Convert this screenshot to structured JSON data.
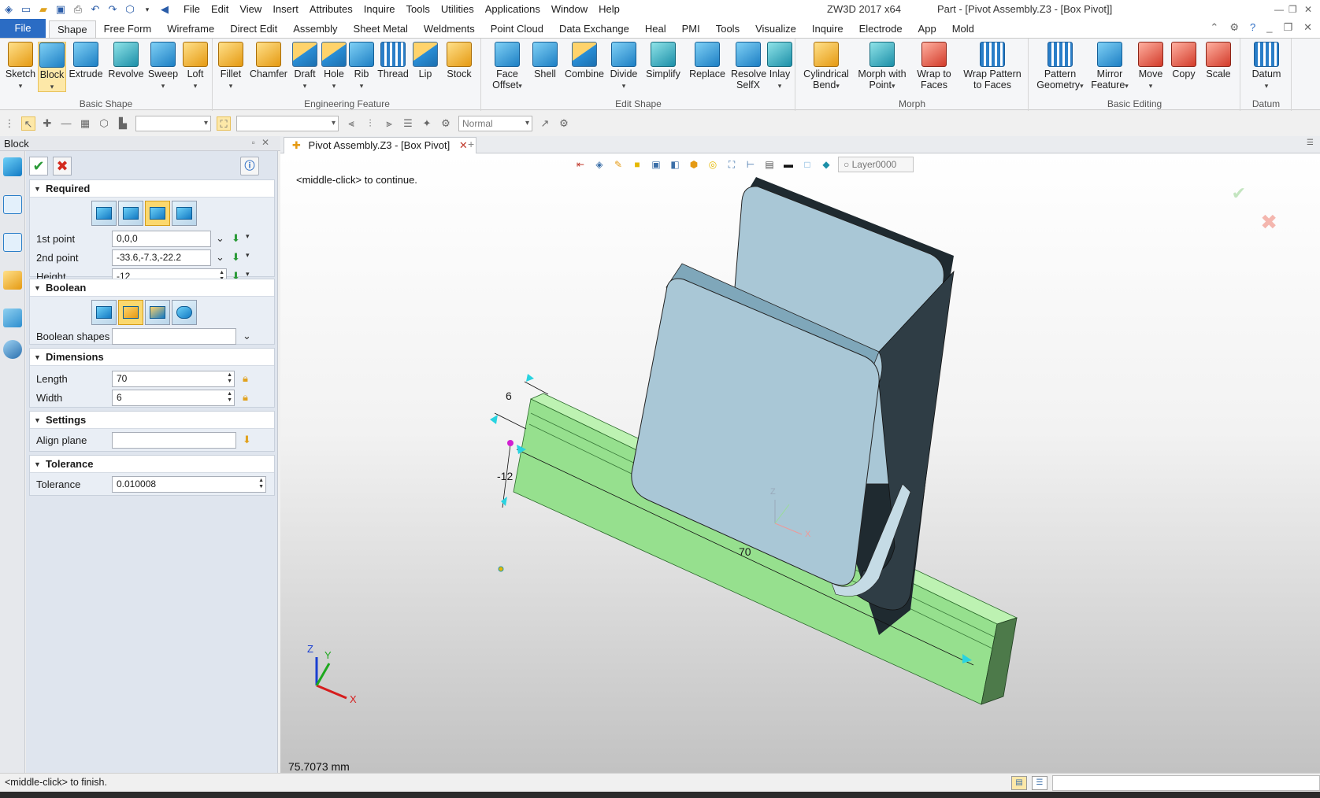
{
  "titlebar": {
    "menus": [
      "File",
      "Edit",
      "View",
      "Insert",
      "Attributes",
      "Inquire",
      "Tools",
      "Utilities",
      "Applications",
      "Window",
      "Help"
    ],
    "app_title": "ZW3D 2017  x64",
    "part_title": "Part - [Pivot Assembly.Z3 - [Box Pivot]]"
  },
  "ribbon_tabs": [
    "File",
    "Shape",
    "Free Form",
    "Wireframe",
    "Direct Edit",
    "Assembly",
    "Sheet Metal",
    "Weldments",
    "Point Cloud",
    "Data Exchange",
    "Heal",
    "PMI",
    "Tools",
    "Visualize",
    "Inquire",
    "Electrode",
    "App",
    "Mold"
  ],
  "active_tab": "Shape",
  "ribbon": {
    "basic_shape": {
      "title": "Basic Shape",
      "buttons": [
        "Sketch",
        "Block",
        "Extrude",
        "Revolve",
        "Sweep",
        "Loft"
      ]
    },
    "engineering_feature": {
      "title": "Engineering Feature",
      "buttons": [
        "Fillet",
        "Chamfer",
        "Draft",
        "Hole",
        "Rib",
        "Thread",
        "Lip",
        "Stock"
      ]
    },
    "edit_shape": {
      "title": "Edit Shape",
      "buttons": [
        "Face Offset",
        "Shell",
        "Combine",
        "Divide",
        "Simplify",
        "Replace",
        "Resolve SelfX",
        "Inlay"
      ]
    },
    "morph": {
      "title": "Morph",
      "buttons": [
        "Cylindrical Bend",
        "Morph with Point",
        "Wrap to Faces",
        "Wrap Pattern to Faces"
      ]
    },
    "basic_editing": {
      "title": "Basic Editing",
      "buttons": [
        "Pattern Geometry",
        "Mirror Feature",
        "Move",
        "Copy",
        "Scale"
      ]
    },
    "datum": {
      "title": "Datum",
      "buttons": [
        "Datum"
      ]
    }
  },
  "toolbar2": {
    "render_mode": "Normal"
  },
  "panel": {
    "title": "Block",
    "required": {
      "title": "Required",
      "first_point_label": "1st point",
      "first_point": "0,0,0",
      "second_point_label": "2nd point",
      "second_point": "-33.6,-7.3,-22.2",
      "height_label": "Height",
      "height": "-12"
    },
    "boolean": {
      "title": "Boolean",
      "shapes_label": "Boolean shapes",
      "shapes": ""
    },
    "dimensions": {
      "title": "Dimensions",
      "length_label": "Length",
      "length": "70",
      "width_label": "Width",
      "width": "6"
    },
    "settings": {
      "title": "Settings",
      "align_label": "Align plane",
      "align": ""
    },
    "tolerance": {
      "title": "Tolerance",
      "tol_label": "Tolerance",
      "tol": "0.010008"
    }
  },
  "document_tab": "Pivot Assembly.Z3 - [Box Pivot]",
  "viewport": {
    "prompt": "<middle-click> to continue.",
    "layer": "Layer0000",
    "measurement": "75.7073 mm",
    "dim_width": "6",
    "dim_height": "-12",
    "dim_length": "70",
    "triad": {
      "x": "X",
      "y": "Y",
      "z": "Z"
    }
  },
  "status": {
    "text": "<middle-click> to finish."
  },
  "colors": {
    "accent": "#2b6cc4",
    "box_green": "#96e08e",
    "part_blue": "#a9c7d6",
    "part_dark": "#2f3d45"
  }
}
